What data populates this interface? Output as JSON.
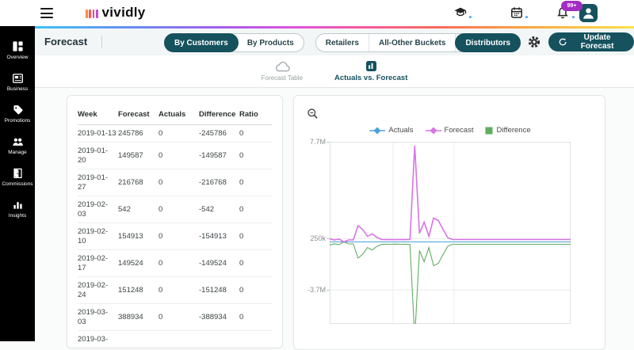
{
  "topbar": {
    "logo_text": "vividly",
    "logo_bar_colors": [
      "#ff8a3c",
      "#ff5252",
      "#f0448c",
      "#c44bd1"
    ],
    "badge": "99+",
    "badge_color": "#a32cc4",
    "avatar_color": "#15525e"
  },
  "sidebar": {
    "items": [
      {
        "label": "Overview",
        "icon": "overview-grid-icon"
      },
      {
        "label": "Business",
        "icon": "business-news-icon"
      },
      {
        "label": "Promotions",
        "icon": "promotions-tag-icon"
      },
      {
        "label": "Manage",
        "icon": "manage-people-icon"
      },
      {
        "label": "Commissions",
        "icon": "commissions-door-icon"
      },
      {
        "label": "Insights",
        "icon": "insights-bars-icon"
      }
    ]
  },
  "header": {
    "title": "Forecast",
    "accent": "#15525e",
    "groups": [
      [
        {
          "label": "By Customers",
          "selected": true
        },
        {
          "label": "By Products",
          "selected": false
        }
      ],
      [
        {
          "label": "Retailers",
          "selected": false
        },
        {
          "label": "All-Other Buckets",
          "selected": false
        },
        {
          "label": "Distributors",
          "selected": true
        }
      ]
    ],
    "update_button_label": "Update Forecast"
  },
  "tabs": [
    {
      "label": "Forecast Table",
      "icon": "cloud-icon",
      "active": false
    },
    {
      "label": "Actuals vs. Forecast",
      "icon": "bars-box-icon",
      "active": true
    }
  ],
  "forecast_table": {
    "columns": [
      "Week",
      "Forecast",
      "Actuals",
      "Difference",
      "Ratio"
    ],
    "rows": [
      {
        "week_lines": [
          "2019-01-13"
        ],
        "forecast": "245786",
        "actuals": "0",
        "difference": "-245786",
        "ratio": "0"
      },
      {
        "week_lines": [
          "2019-01-",
          "20"
        ],
        "forecast": "149587",
        "actuals": "0",
        "difference": "-149587",
        "ratio": "0"
      },
      {
        "week_lines": [
          "2019-01-",
          "27"
        ],
        "forecast": "216768",
        "actuals": "0",
        "difference": "-216768",
        "ratio": "0"
      },
      {
        "week_lines": [
          "2019-02-",
          "03"
        ],
        "forecast": "542",
        "actuals": "0",
        "difference": "-542",
        "ratio": "0"
      },
      {
        "week_lines": [
          "2019-02-",
          "10"
        ],
        "forecast": "154913",
        "actuals": "0",
        "difference": "-154913",
        "ratio": "0"
      },
      {
        "week_lines": [
          "2019-02-",
          "17"
        ],
        "forecast": "149524",
        "actuals": "0",
        "difference": "-149524",
        "ratio": "0"
      },
      {
        "week_lines": [
          "2019-02-",
          "24"
        ],
        "forecast": "151248",
        "actuals": "0",
        "difference": "-151248",
        "ratio": "0"
      },
      {
        "week_lines": [
          "2019-03-",
          "03"
        ],
        "forecast": "388934",
        "actuals": "0",
        "difference": "-388934",
        "ratio": "0"
      },
      {
        "week_lines": [
          "2019-03-"
        ],
        "forecast": "",
        "actuals": "",
        "difference": "",
        "ratio": ""
      }
    ]
  },
  "chart_data": {
    "type": "line",
    "title": "",
    "x_unit": "week",
    "x_start": "2019-01-13",
    "legend_position": "top",
    "grid": true,
    "x_gridline_fracs": [
      0.263,
      0.516
    ],
    "ylim": [
      -6300000,
      7700000
    ],
    "y_ticks": [
      {
        "label": "7.7M",
        "value": 7700000
      },
      {
        "label": "250k",
        "value": 250000
      },
      {
        "label": "-3.7M",
        "value": -3700000
      }
    ],
    "legend": [
      {
        "name": "Actuals",
        "color": "#4aa3d8",
        "marker": "diamond-line"
      },
      {
        "name": "Forecast",
        "color": "#d873e6",
        "marker": "diamond-line"
      },
      {
        "name": "Difference",
        "color": "#5fae5f",
        "marker": "square"
      }
    ],
    "series": [
      {
        "name": "Actuals",
        "color": "#4aa3d8",
        "width": 1,
        "values": [
          0,
          0,
          0,
          0,
          0,
          0,
          0,
          0,
          0,
          0,
          0,
          0,
          0,
          0,
          0,
          0,
          0,
          0,
          0,
          0,
          0,
          0,
          0,
          0,
          0,
          0,
          0,
          0,
          0,
          0,
          0,
          0,
          0,
          0,
          0,
          0,
          0,
          0,
          0,
          0,
          0,
          0,
          0,
          0,
          0,
          0,
          0,
          0,
          0,
          0,
          0,
          0
        ]
      },
      {
        "name": "Forecast",
        "color": "#d873e6",
        "width": 1.6,
        "values": [
          245786,
          149587,
          216768,
          542,
          154913,
          149524,
          1250000,
          950000,
          430000,
          620000,
          340000,
          190000,
          175000,
          185000,
          170000,
          180000,
          175000,
          185000,
          7400000,
          660000,
          1520000,
          430000,
          1830000,
          1650000,
          960000,
          330000,
          185000,
          185000,
          185000,
          185000,
          185000,
          185000,
          185000,
          185000,
          185000,
          185000,
          185000,
          185000,
          185000,
          185000,
          185000,
          185000,
          185000,
          185000,
          185000,
          185000,
          185000,
          185000,
          185000,
          185000,
          185000,
          185000
        ]
      },
      {
        "name": "Difference",
        "color": "#5fae5f",
        "width": 1.1,
        "values": [
          -245786,
          -149587,
          -216768,
          -542,
          -154913,
          -149524,
          -1250000,
          -950000,
          -430000,
          -620000,
          -340000,
          -190000,
          -175000,
          -185000,
          -170000,
          -180000,
          -175000,
          -185000,
          -7400000,
          -660000,
          -1520000,
          -430000,
          -1830000,
          -1650000,
          -960000,
          -330000,
          -185000,
          -185000,
          -185000,
          -185000,
          -185000,
          -185000,
          -185000,
          -185000,
          -185000,
          -185000,
          -185000,
          -185000,
          -185000,
          -185000,
          -185000,
          -185000,
          -185000,
          -185000,
          -185000,
          -185000,
          -185000,
          -185000,
          -185000,
          -185000,
          -185000,
          -185000
        ]
      }
    ]
  }
}
